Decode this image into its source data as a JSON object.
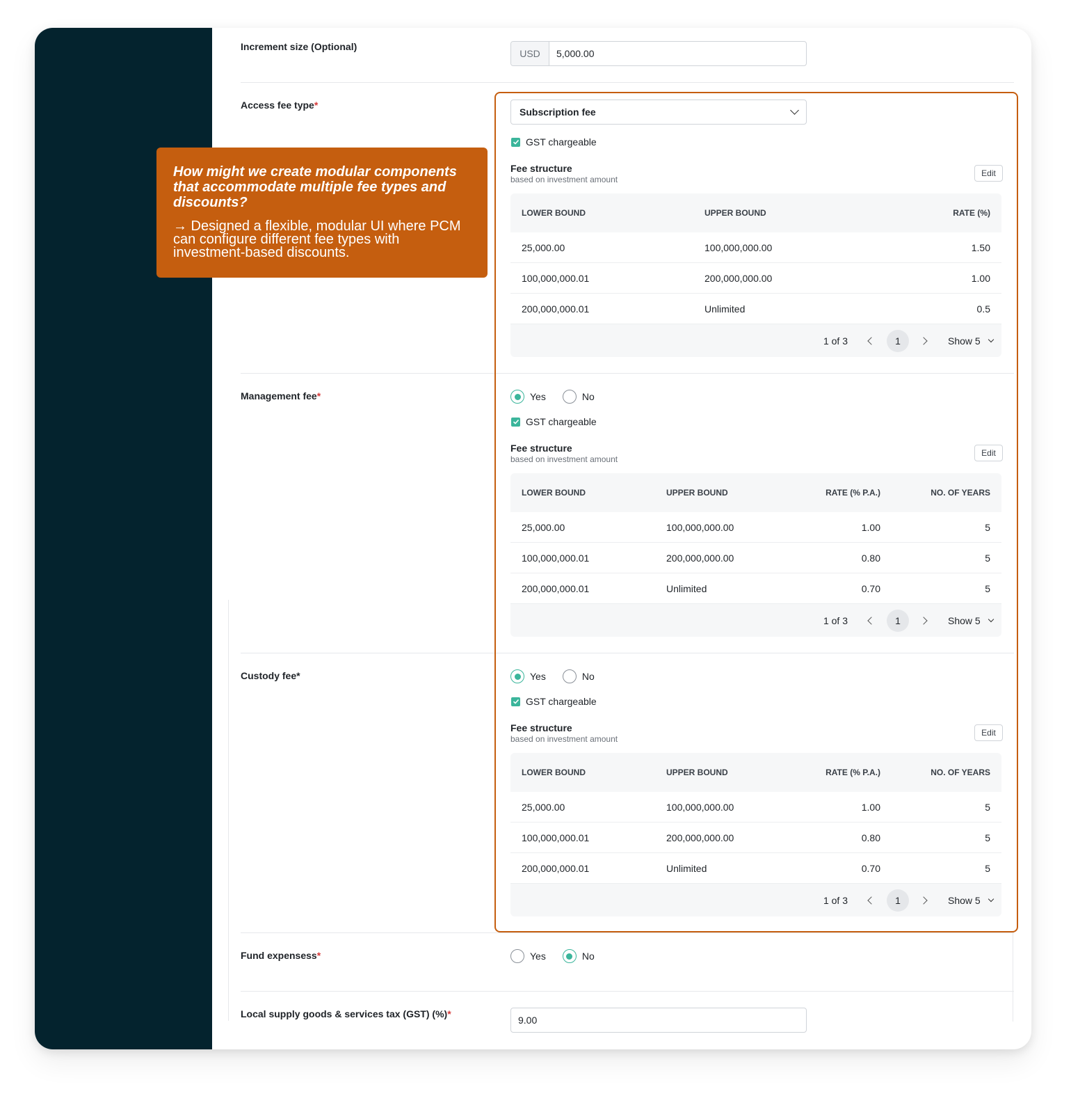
{
  "increment": {
    "label": "Increment size (Optional)",
    "currency": "USD",
    "value": "5,000.00"
  },
  "access_fee": {
    "label": "Access fee type",
    "required_mark": "*",
    "selected": "Subscription fee",
    "gst_label": "GST chargeable",
    "fee_structure": {
      "title": "Fee structure",
      "subtitle": "based on investment amount",
      "edit_label": "Edit",
      "columns": [
        "LOWER BOUND",
        "UPPER BOUND",
        "RATE (%)"
      ],
      "rows": [
        [
          "25,000.00",
          "100,000,000.00",
          "1.50"
        ],
        [
          "100,000,000.01",
          "200,000,000.00",
          "1.00"
        ],
        [
          "200,000,000.01",
          "Unlimited",
          "0.5"
        ]
      ],
      "pagination": {
        "text": "1 of 3",
        "page": "1",
        "show": "Show 5"
      }
    }
  },
  "management_fee": {
    "label": "Management fee",
    "required_mark": "*",
    "yes_label": "Yes",
    "no_label": "No",
    "gst_label": "GST chargeable",
    "fee_structure": {
      "title": "Fee structure",
      "subtitle": "based on investment amount",
      "edit_label": "Edit",
      "columns": [
        "LOWER BOUND",
        "UPPER BOUND",
        "RATE (% P.A.)",
        "NO. OF YEARS"
      ],
      "rows": [
        [
          "25,000.00",
          "100,000,000.00",
          "1.00",
          "5"
        ],
        [
          "100,000,000.01",
          "200,000,000.00",
          "0.80",
          "5"
        ],
        [
          "200,000,000.01",
          "Unlimited",
          "0.70",
          "5"
        ]
      ],
      "pagination": {
        "text": "1 of 3",
        "page": "1",
        "show": "Show 5"
      }
    }
  },
  "custody_fee": {
    "label": "Custody fee*",
    "yes_label": "Yes",
    "no_label": "No",
    "gst_label": "GST chargeable",
    "fee_structure": {
      "title": "Fee structure",
      "subtitle": "based on investment amount",
      "edit_label": "Edit",
      "columns": [
        "LOWER BOUND",
        "UPPER BOUND",
        "RATE (% P.A.)",
        "NO. OF YEARS"
      ],
      "rows": [
        [
          "25,000.00",
          "100,000,000.00",
          "1.00",
          "5"
        ],
        [
          "100,000,000.01",
          "200,000,000.00",
          "0.80",
          "5"
        ],
        [
          "200,000,000.01",
          "Unlimited",
          "0.70",
          "5"
        ]
      ],
      "pagination": {
        "text": "1 of 3",
        "page": "1",
        "show": "Show 5"
      }
    }
  },
  "fund_expenses": {
    "label": "Fund expensess",
    "required_mark": "*",
    "yes_label": "Yes",
    "no_label": "No"
  },
  "gst": {
    "label": "Local supply goods & services tax (GST) (%)",
    "required_mark": "*",
    "value": "9.00"
  },
  "callout": {
    "question": "How might we create modular components that accommodate multiple fee types and discounts?",
    "answer": "→ Designed a flexible, modular UI where PCM can configure different fee types with investment-based discounts."
  },
  "colors": {
    "sidebar": "#04232e",
    "accent": "#c55e0f",
    "check": "#3bb59b"
  }
}
